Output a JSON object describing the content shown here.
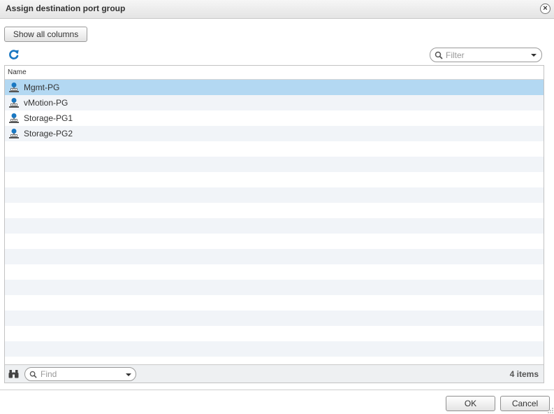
{
  "dialog": {
    "title": "Assign destination port group",
    "close_symbol": "×"
  },
  "toolbar": {
    "show_all_columns_label": "Show all columns",
    "refresh_icon": "refresh-icon"
  },
  "filter": {
    "placeholder": "Filter"
  },
  "grid": {
    "column_header": "Name",
    "rows": [
      {
        "name": "Mgmt-PG",
        "selected": true
      },
      {
        "name": "vMotion-PG",
        "selected": false
      },
      {
        "name": "Storage-PG1",
        "selected": false
      },
      {
        "name": "Storage-PG2",
        "selected": false
      }
    ],
    "row_icon": "port-group-icon"
  },
  "footer": {
    "find_placeholder": "Find",
    "item_count": "4 items"
  },
  "actions": {
    "ok_label": "OK",
    "cancel_label": "Cancel"
  },
  "colors": {
    "selected_row": "#b3d8f2",
    "alt_row": "#f1f4f8",
    "accent_icon": "#1a78c2"
  }
}
